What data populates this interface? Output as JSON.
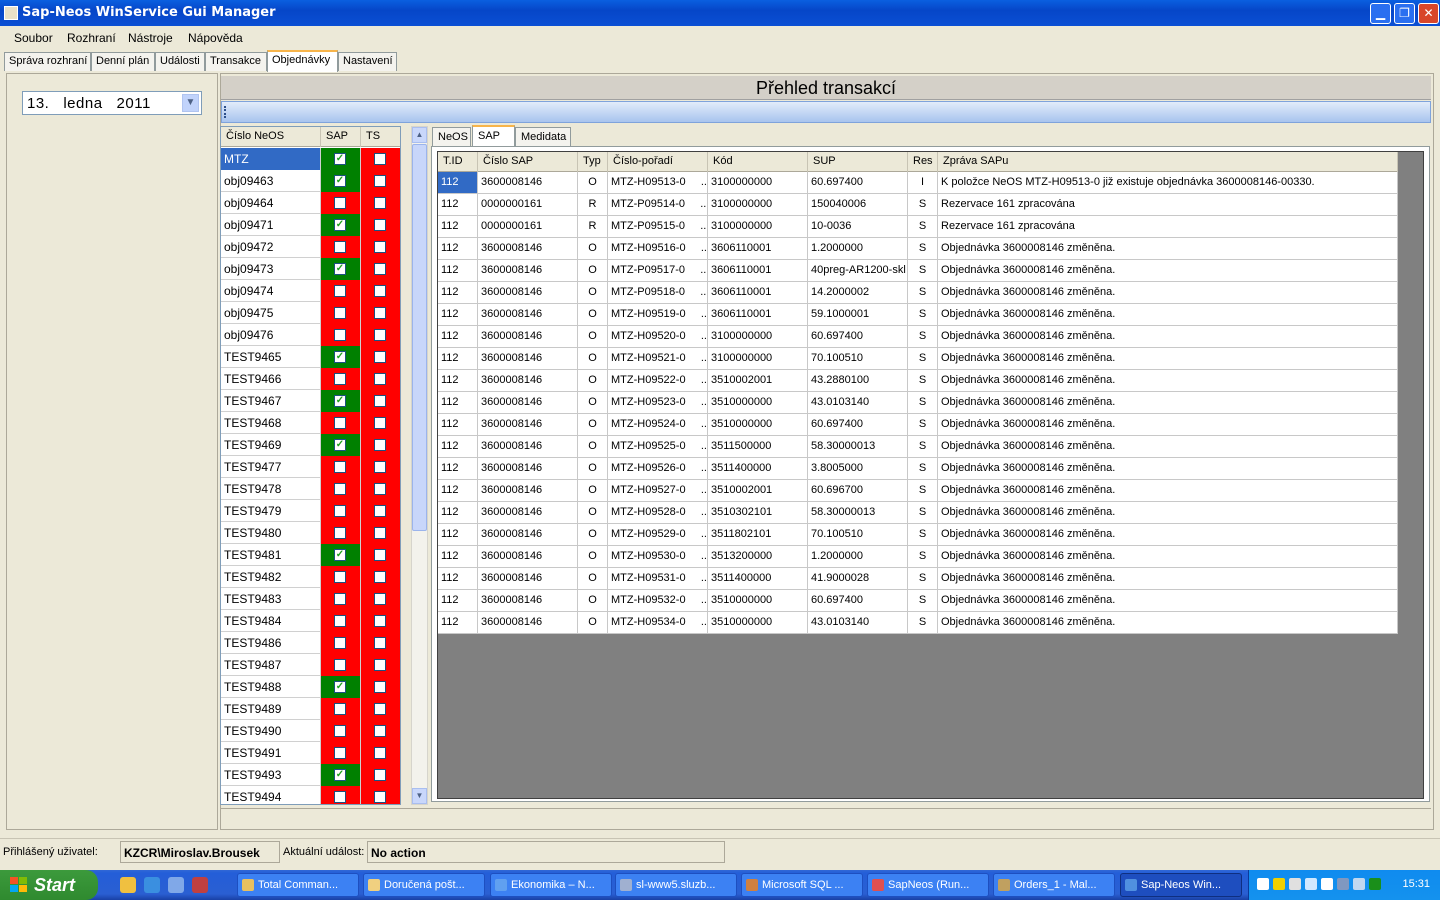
{
  "window": {
    "title": "Sap-Neos WinService Gui Manager"
  },
  "menu": [
    "Soubor",
    "Rozhraní",
    "Nástroje",
    "Nápověda"
  ],
  "tabs": [
    "Správa rozhraní",
    "Denní plán",
    "Události",
    "Transakce",
    "Objednávky",
    "Nastavení"
  ],
  "active_tab": "Objednávky",
  "date_picker": {
    "value": "13.   ledna   2011"
  },
  "page_title": "Přehled transakcí",
  "neos_table": {
    "headers": [
      "Číslo NeOS",
      "SAP",
      "TS"
    ],
    "rows": [
      {
        "name": "MTZ",
        "sap": true,
        "selected": true
      },
      {
        "name": "obj09463",
        "sap": true
      },
      {
        "name": "obj09464",
        "sap": false
      },
      {
        "name": "obj09471",
        "sap": true
      },
      {
        "name": "obj09472",
        "sap": false
      },
      {
        "name": "obj09473",
        "sap": true
      },
      {
        "name": "obj09474",
        "sap": false
      },
      {
        "name": "obj09475",
        "sap": false
      },
      {
        "name": "obj09476",
        "sap": false
      },
      {
        "name": "TEST9465",
        "sap": true
      },
      {
        "name": "TEST9466",
        "sap": false
      },
      {
        "name": "TEST9467",
        "sap": true
      },
      {
        "name": "TEST9468",
        "sap": false
      },
      {
        "name": "TEST9469",
        "sap": true
      },
      {
        "name": "TEST9477",
        "sap": false
      },
      {
        "name": "TEST9478",
        "sap": false
      },
      {
        "name": "TEST9479",
        "sap": false
      },
      {
        "name": "TEST9480",
        "sap": false
      },
      {
        "name": "TEST9481",
        "sap": true
      },
      {
        "name": "TEST9482",
        "sap": false
      },
      {
        "name": "TEST9483",
        "sap": false
      },
      {
        "name": "TEST9484",
        "sap": false
      },
      {
        "name": "TEST9486",
        "sap": false
      },
      {
        "name": "TEST9487",
        "sap": false
      },
      {
        "name": "TEST9488",
        "sap": true
      },
      {
        "name": "TEST9489",
        "sap": false
      },
      {
        "name": "TEST9490",
        "sap": false
      },
      {
        "name": "TEST9491",
        "sap": false
      },
      {
        "name": "TEST9493",
        "sap": true
      },
      {
        "name": "TEST9494",
        "sap": false
      }
    ]
  },
  "sub_tabs": [
    "NeOS",
    "SAP",
    "Medidata"
  ],
  "active_sub_tab": "SAP",
  "grid": {
    "headers": [
      "T.ID",
      "Číslo SAP",
      "Typ",
      "Číslo-pořadí",
      "Kód",
      "SUP",
      "Res",
      "Zpráva SAPu"
    ],
    "rows": [
      [
        "112",
        "3600008146",
        "O",
        "MTZ-H09513-0     ...",
        "3100000000",
        "60.697400",
        "I",
        "K položce NeOS MTZ-H09513-0 již existuje objednávka 3600008146-00330."
      ],
      [
        "112",
        "0000000161",
        "R",
        "MTZ-P09514-0     ...",
        "3100000000",
        "150040006",
        "S",
        "Rezervace 161 zpracována"
      ],
      [
        "112",
        "0000000161",
        "R",
        "MTZ-P09515-0     ...",
        "3100000000",
        "10-0036",
        "S",
        "Rezervace 161 zpracována"
      ],
      [
        "112",
        "3600008146",
        "O",
        "MTZ-H09516-0     ...",
        "3606110001",
        "1.2000000",
        "S",
        "Objednávka 3600008146 změněna."
      ],
      [
        "112",
        "3600008146",
        "O",
        "MTZ-P09517-0     ...",
        "3606110001",
        "40preg-AR1200-skl",
        "S",
        "Objednávka 3600008146 změněna."
      ],
      [
        "112",
        "3600008146",
        "O",
        "MTZ-P09518-0     ...",
        "3606110001",
        "14.2000002",
        "S",
        "Objednávka 3600008146 změněna."
      ],
      [
        "112",
        "3600008146",
        "O",
        "MTZ-H09519-0     ...",
        "3606110001",
        "59.1000001",
        "S",
        "Objednávka 3600008146 změněna."
      ],
      [
        "112",
        "3600008146",
        "O",
        "MTZ-H09520-0     ...",
        "3100000000",
        "60.697400",
        "S",
        "Objednávka 3600008146 změněna."
      ],
      [
        "112",
        "3600008146",
        "O",
        "MTZ-H09521-0     ...",
        "3100000000",
        "70.100510",
        "S",
        "Objednávka 3600008146 změněna."
      ],
      [
        "112",
        "3600008146",
        "O",
        "MTZ-H09522-0     ...",
        "3510002001",
        "43.2880100",
        "S",
        "Objednávka 3600008146 změněna."
      ],
      [
        "112",
        "3600008146",
        "O",
        "MTZ-H09523-0     ...",
        "3510000000",
        "43.0103140",
        "S",
        "Objednávka 3600008146 změněna."
      ],
      [
        "112",
        "3600008146",
        "O",
        "MTZ-H09524-0     ...",
        "3510000000",
        "60.697400",
        "S",
        "Objednávka 3600008146 změněna."
      ],
      [
        "112",
        "3600008146",
        "O",
        "MTZ-H09525-0     ...",
        "3511500000",
        "58.30000013",
        "S",
        "Objednávka 3600008146 změněna."
      ],
      [
        "112",
        "3600008146",
        "O",
        "MTZ-H09526-0     ...",
        "3511400000",
        "3.8005000",
        "S",
        "Objednávka 3600008146 změněna."
      ],
      [
        "112",
        "3600008146",
        "O",
        "MTZ-H09527-0     ...",
        "3510002001",
        "60.696700",
        "S",
        "Objednávka 3600008146 změněna."
      ],
      [
        "112",
        "3600008146",
        "O",
        "MTZ-H09528-0     ...",
        "3510302101",
        "58.30000013",
        "S",
        "Objednávka 3600008146 změněna."
      ],
      [
        "112",
        "3600008146",
        "O",
        "MTZ-H09529-0     ...",
        "3511802101",
        "70.100510",
        "S",
        "Objednávka 3600008146 změněna."
      ],
      [
        "112",
        "3600008146",
        "O",
        "MTZ-H09530-0     ...",
        "3513200000",
        "1.2000000",
        "S",
        "Objednávka 3600008146 změněna."
      ],
      [
        "112",
        "3600008146",
        "O",
        "MTZ-H09531-0     ...",
        "3511400000",
        "41.9000028",
        "S",
        "Objednávka 3600008146 změněna."
      ],
      [
        "112",
        "3600008146",
        "O",
        "MTZ-H09532-0     ...",
        "3510000000",
        "60.697400",
        "S",
        "Objednávka 3600008146 změněna."
      ],
      [
        "112",
        "3600008146",
        "O",
        "MTZ-H09534-0     ...",
        "3510000000",
        "43.0103140",
        "S",
        "Objednávka 3600008146 změněna."
      ]
    ]
  },
  "status": {
    "user_label": "Přihlášený uživatel:",
    "user_value": "KZCR\\Miroslav.Brousek",
    "event_label": "Aktuální událost:",
    "event_value": "No action"
  },
  "taskbar": {
    "start": "Start",
    "buttons": [
      "Total Comman...",
      "Doručená pošt...",
      "Ekonomika – N...",
      "sl-www5.sluzb...",
      "Microsoft SQL ...",
      "SapNeos (Run...",
      "Orders_1 - Mal...",
      "Sap-Neos Win..."
    ],
    "clock": "15:31"
  },
  "colors": {
    "sap_ok": "#008000",
    "sap_missing": "#ff0000",
    "selection": "#316ac5",
    "titlebar": "#0a5fe0"
  }
}
